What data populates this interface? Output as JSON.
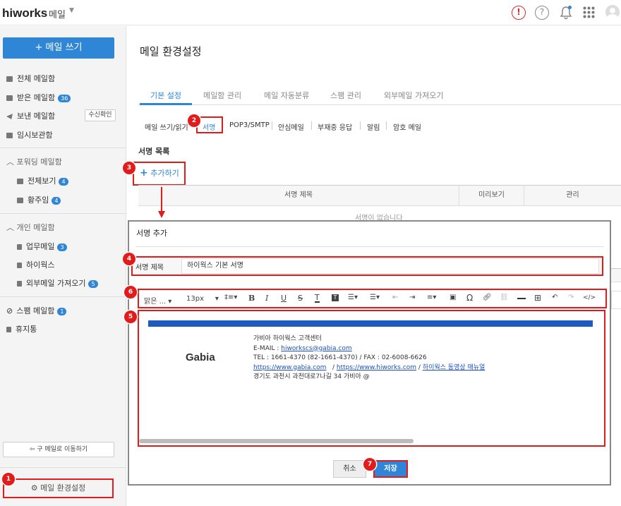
{
  "topbar": {
    "logo": "hiworks",
    "app_name": "메일",
    "alert_glyph": "!",
    "help_glyph": "?"
  },
  "sidebar": {
    "write_label": "+ 메일 쓰기",
    "mailboxes": [
      {
        "label": "전체 메일함",
        "count": ""
      },
      {
        "label": "받은 메일함",
        "count": "36"
      },
      {
        "label": "보낸 메일함",
        "count": ""
      },
      {
        "label": "임시보관함",
        "count": ""
      }
    ],
    "read_check_label": "수신확인",
    "forward_section": "포워딩 메일함",
    "forward_items": [
      {
        "label": "전체보기",
        "count": "4"
      },
      {
        "label": "황주임",
        "count": "4"
      }
    ],
    "personal_section": "개인 메일함",
    "personal_items": [
      {
        "label": "업무메일",
        "count": "3"
      },
      {
        "label": "하이웍스",
        "count": ""
      },
      {
        "label": "외부메일 가져오기",
        "count": "5"
      }
    ],
    "spam": {
      "label": "스팸 메일함",
      "count": "1"
    },
    "trash": {
      "label": "휴지통"
    },
    "old_ui_label": "구 메일로 이동하기",
    "settings_label": "메일 환경설정"
  },
  "main": {
    "title": "메일 환경설정",
    "tabs": [
      "기본 설정",
      "메일함 관리",
      "메일 자동분류",
      "스팸 관리",
      "외부메일 가져오기"
    ],
    "subtabs": [
      "메일 쓰기/읽기",
      "서명",
      "POP3/SMTP",
      "안심메일",
      "부재중 응답",
      "알림",
      "암호 메일"
    ],
    "section_title": "서명 목록",
    "add_label": "추가하기",
    "table_headers": [
      "서명 제목",
      "미리보기",
      "관리"
    ],
    "empty_text": "서명이 없습니다"
  },
  "modal": {
    "title": "서명 추가",
    "field_label": "서명 제목",
    "field_value": "하이웍스 기본 서명",
    "toolbar": {
      "font": "맑은 ...",
      "size": "13px"
    },
    "signature": {
      "logo": "Gabia",
      "line1": "가비아 하이웍스 고객센터",
      "email_prefix": "E-MAIL : ",
      "email": "hiworkscs@gabia.com",
      "tel": "TEL : 1661-4370 (82-1661-4370) / FAX : 02-6008-6626",
      "link1": "https://www.gabia.com",
      "link2": "https://www.hiworks.com",
      "link3": "하이웍스 동영상 매뉴얼",
      "address": "경기도 과천시 과천대로7나길 34 가비아 @"
    },
    "cancel_label": "취소",
    "save_label": "저장"
  },
  "markers": [
    "1",
    "2",
    "3",
    "4",
    "5",
    "6",
    "7"
  ],
  "colors": {
    "accent": "#2f86d6",
    "highlight": "#e21b1b",
    "signature_bar": "#1f5bbf"
  }
}
